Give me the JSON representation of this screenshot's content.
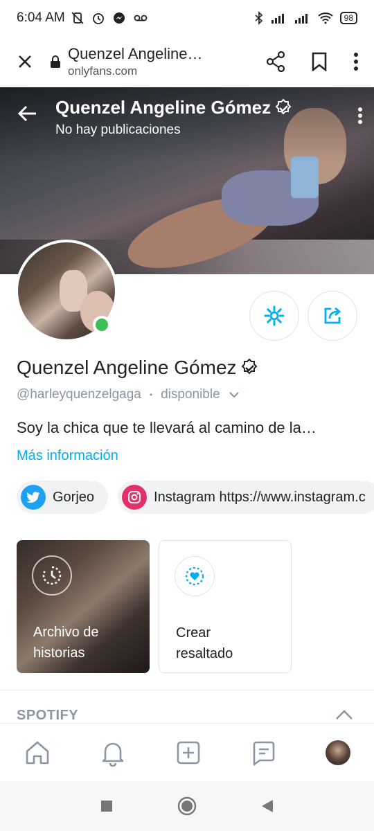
{
  "status_bar": {
    "time": "6:04 AM",
    "battery": "98"
  },
  "browser": {
    "title": "Quenzel Angeline…",
    "domain": "onlyfans.com"
  },
  "cover": {
    "name": "Quenzel Angeline Gómez",
    "subtitle": "No hay publicaciones"
  },
  "profile": {
    "name": "Quenzel Angeline Gómez",
    "handle": "@harleyquenzelgaga",
    "separator": "•",
    "availability": "disponible",
    "bio": "Soy la chica que te llevará al camino de la…",
    "more_info": "Más información"
  },
  "links": [
    {
      "label": "Gorjeo",
      "icon": "twitter-icon",
      "color": "#1da1f2"
    },
    {
      "label": "Instagram https://www.instagram.c",
      "icon": "instagram-icon",
      "color": "#e1306c"
    }
  ],
  "highlights": [
    {
      "label_line1": "Archivo de",
      "label_line2": "historias",
      "icon": "story-archive-icon"
    },
    {
      "label_line1": "Crear",
      "label_line2": "resaltado",
      "icon": "heart-highlight-icon"
    }
  ],
  "section": {
    "title": "SPOTIFY"
  },
  "bottom_nav": [
    "home-icon",
    "bell-icon",
    "add-post-icon",
    "messages-icon",
    "profile-avatar"
  ],
  "colors": {
    "accent": "#00aff0",
    "online": "#3bbf54",
    "muted": "#8a96a3"
  }
}
